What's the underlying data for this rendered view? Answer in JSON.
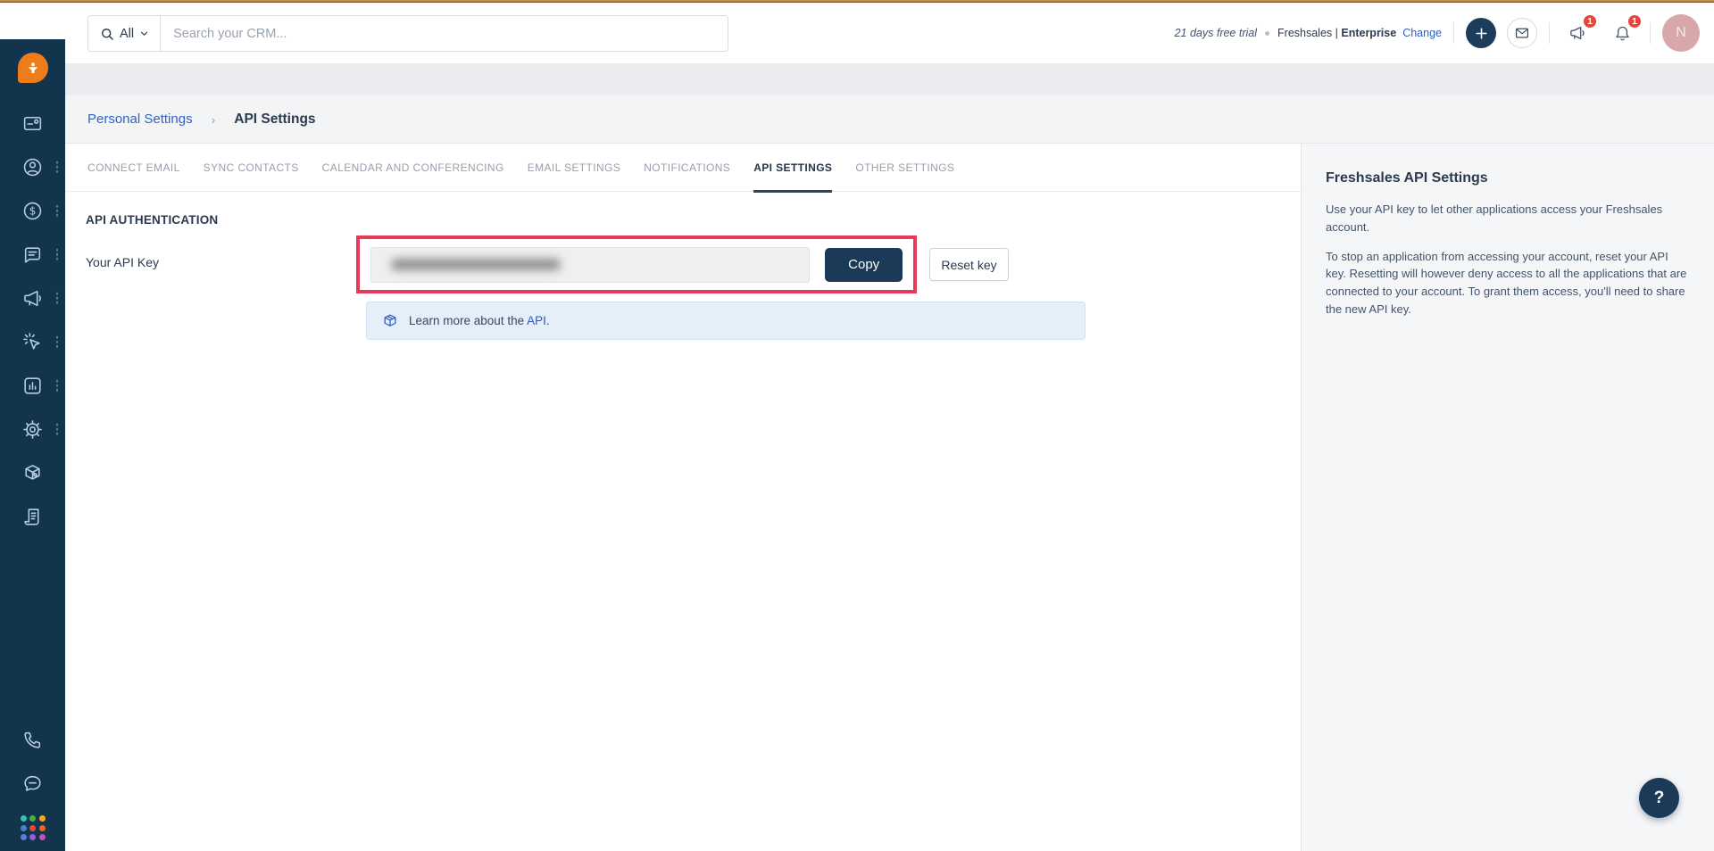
{
  "topbar": {
    "search": {
      "scope_label": "All",
      "placeholder": "Search your CRM..."
    },
    "trial_text": "21 days free trial",
    "product_name": "Freshsales |",
    "plan_name": "Enterprise",
    "change_link": "Change",
    "announcement_badge": "1",
    "notification_badge": "1",
    "avatar_initial": "N",
    "icons": [
      "search-icon",
      "chevron-down-icon",
      "plus-icon",
      "envelope-icon",
      "announcement-icon",
      "bell-icon"
    ]
  },
  "sidebar": {
    "icons": [
      "freshworks-logo",
      "pipeline-icon",
      "contacts-icon",
      "deals-icon",
      "conversations-icon",
      "marketing-icon",
      "sales-sequences-icon",
      "analytics-icon",
      "settings-icon",
      "marketplace-icon",
      "changelog-icon",
      "phone-icon",
      "chat-icon",
      "apps-grid-icon"
    ],
    "app_grid_colors": [
      "#2ec4b6",
      "#47b04b",
      "#f5a623",
      "#4a7fd4",
      "#e8453c",
      "#f2641c",
      "#5f78e0",
      "#9b5bd2",
      "#c44fb6"
    ]
  },
  "breadcrumb": {
    "parent": "Personal Settings",
    "separator": "›",
    "current": "API Settings"
  },
  "tabs": [
    {
      "label": "CONNECT EMAIL",
      "active": false
    },
    {
      "label": "SYNC CONTACTS",
      "active": false
    },
    {
      "label": "CALENDAR AND CONFERENCING",
      "active": false
    },
    {
      "label": "EMAIL SETTINGS",
      "active": false
    },
    {
      "label": "NOTIFICATIONS",
      "active": false
    },
    {
      "label": "API SETTINGS",
      "active": true
    },
    {
      "label": "OTHER SETTINGS",
      "active": false
    }
  ],
  "content": {
    "section_title": "API AUTHENTICATION",
    "api_key_label": "Your API Key",
    "api_key_redacted": true,
    "copy_button": "Copy",
    "reset_button": "Reset key",
    "info_text_prefix": "Learn more about the ",
    "info_link_text": "API",
    "info_text_suffix": "."
  },
  "side_panel": {
    "title": "Freshsales API Settings",
    "paragraphs": [
      "Use your API key to let other applications access your Freshsales account.",
      "To stop an application from accessing your account, reset your API key. Resetting will however deny access to all the applications that are connected to your account. To grant them access, you'll need to share the new API key."
    ]
  },
  "help_button_label": "?",
  "colors": {
    "sidebar_navy": "#12344d",
    "primary_navy": "#1b3a58",
    "highlight_red": "#e23b5b",
    "link_blue": "#2c5cc5",
    "badge_red": "#e8453c",
    "brand_orange": "#ef7c1a",
    "info_bg": "#e4effa",
    "avatar_pink": "#d8a7a9"
  }
}
